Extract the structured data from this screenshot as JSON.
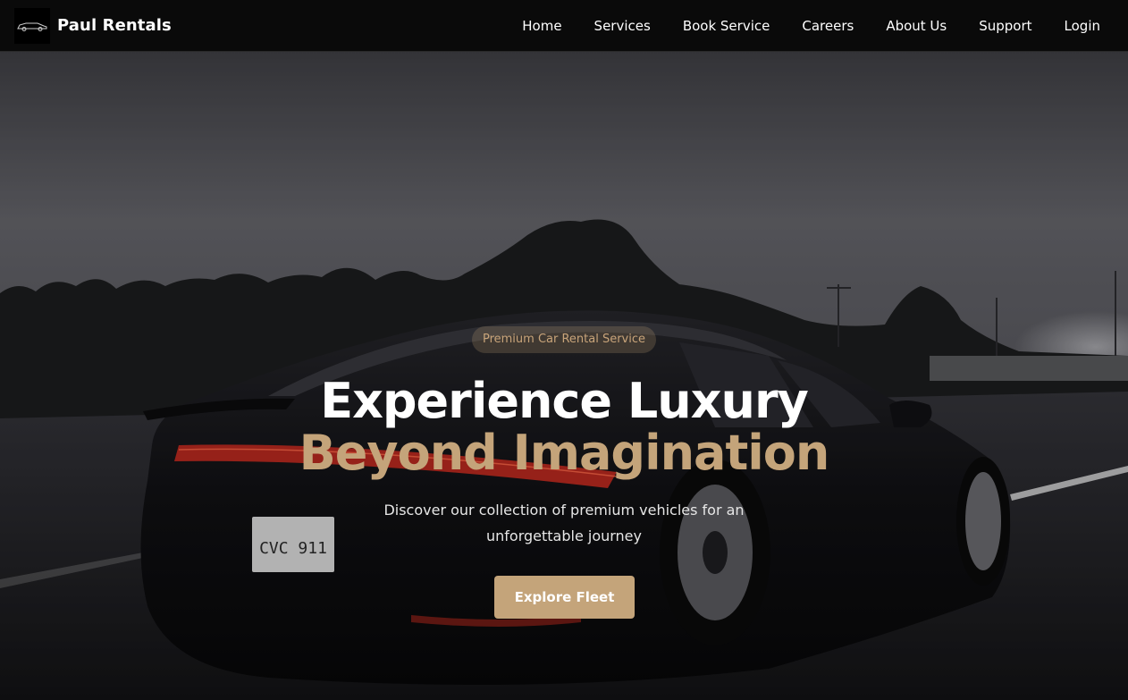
{
  "brand": {
    "name": "Paul Rentals",
    "logo_icon": "car-logo-icon"
  },
  "nav": {
    "items": [
      {
        "label": "Home"
      },
      {
        "label": "Services"
      },
      {
        "label": "Book Service"
      },
      {
        "label": "Careers"
      },
      {
        "label": "About Us"
      },
      {
        "label": "Support"
      },
      {
        "label": "Login"
      }
    ]
  },
  "hero": {
    "badge": "Premium Car Rental Service",
    "title_line1": "Experience Luxury",
    "title_line2": "Beyond Imagination",
    "subtitle": "Discover our collection of premium vehicles for an unforgettable journey",
    "cta_label": "Explore Fleet",
    "license_plate": "CVC 911",
    "accent_color": "#c4a47a"
  }
}
